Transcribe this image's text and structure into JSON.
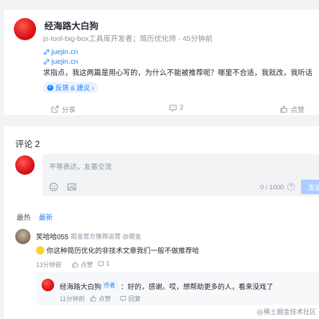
{
  "post": {
    "author": "经海路大白狗",
    "subtitle": "js-tool-big-box工具库开发者；简历优化师 · 45分钟前",
    "links": [
      "juejin.cn",
      "juejin.cn"
    ],
    "text": "求指点，我这两篇是用心写的，为什么不能被推荐呢？哪里不合适，我就改，我听话",
    "feedback": "反馈 & 建议 ›",
    "share_label": "分享",
    "comment_count": "2",
    "like_label": "点赞"
  },
  "comments": {
    "title": "评论 2",
    "composer": {
      "placeholder": "平等表达，友善交流",
      "counter": "0 / 1000",
      "help": "?",
      "send_label": "发送"
    },
    "sort": [
      "最热",
      "最新"
    ],
    "items": [
      {
        "name": "笑哈哈055",
        "meta": "掘金官方推荐运营 @掘金",
        "text": "你这种简历优化的非技术文章我们一般不做推荐哈",
        "time": "13分钟前",
        "like": "点赞",
        "reply_count": "1",
        "replies": [
          {
            "name": "经海路大白狗",
            "badge": "作者",
            "text": "：好的，感谢。哎，想帮助更多的人，看来没戏了",
            "time": "11分钟前",
            "like": "点赞",
            "reply": "回复"
          }
        ]
      }
    ]
  },
  "watermark": "@稀土掘金技术社区",
  "colors": {
    "accent": "#1e80ff",
    "bg": "#f2f3f5",
    "muted": "#8a919f"
  }
}
